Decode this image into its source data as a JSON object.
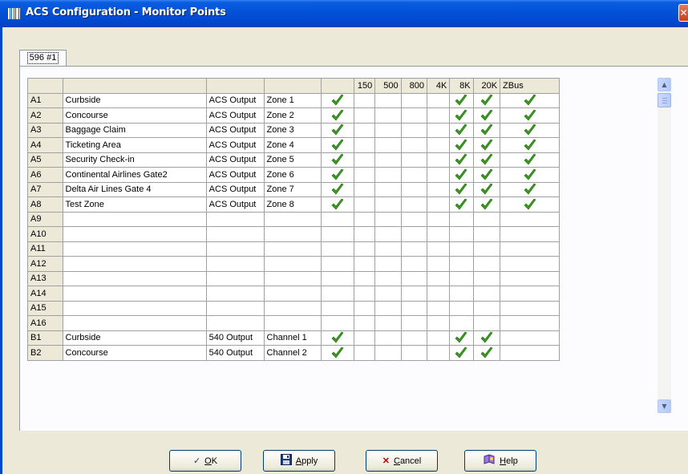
{
  "window": {
    "title": "ACS Configuration - Monitor Points",
    "close_glyph": "✕"
  },
  "tabs": [
    {
      "label": "596 #1",
      "selected": true
    }
  ],
  "grid": {
    "headers": [
      "",
      "",
      "",
      "",
      "",
      "150",
      "500",
      "800",
      "4K",
      "8K",
      "20K",
      "ZBus"
    ],
    "rows": [
      {
        "id": "A1",
        "name": "Curbside",
        "output": "ACS Output",
        "zone": "Zone 1",
        "enabled": true,
        "c150": false,
        "c500": false,
        "c800": false,
        "c4k": false,
        "c8k": true,
        "c20k": true,
        "zbus": true
      },
      {
        "id": "A2",
        "name": "Concourse",
        "output": "ACS Output",
        "zone": "Zone 2",
        "enabled": true,
        "c150": false,
        "c500": false,
        "c800": false,
        "c4k": false,
        "c8k": true,
        "c20k": true,
        "zbus": true
      },
      {
        "id": "A3",
        "name": "Baggage Claim",
        "output": "ACS Output",
        "zone": "Zone 3",
        "enabled": true,
        "c150": false,
        "c500": false,
        "c800": false,
        "c4k": false,
        "c8k": true,
        "c20k": true,
        "zbus": true
      },
      {
        "id": "A4",
        "name": "Ticketing Area",
        "output": "ACS Output",
        "zone": "Zone 4",
        "enabled": true,
        "c150": false,
        "c500": false,
        "c800": false,
        "c4k": false,
        "c8k": true,
        "c20k": true,
        "zbus": true
      },
      {
        "id": "A5",
        "name": "Security Check-in",
        "output": "ACS Output",
        "zone": "Zone 5",
        "enabled": true,
        "c150": false,
        "c500": false,
        "c800": false,
        "c4k": false,
        "c8k": true,
        "c20k": true,
        "zbus": true
      },
      {
        "id": "A6",
        "name": "Continental Airlines Gate2",
        "output": "ACS Output",
        "zone": "Zone 6",
        "enabled": true,
        "c150": false,
        "c500": false,
        "c800": false,
        "c4k": false,
        "c8k": true,
        "c20k": true,
        "zbus": true
      },
      {
        "id": "A7",
        "name": "Delta Air Lines Gate 4",
        "output": "ACS Output",
        "zone": "Zone 7",
        "enabled": true,
        "c150": false,
        "c500": false,
        "c800": false,
        "c4k": false,
        "c8k": true,
        "c20k": true,
        "zbus": true
      },
      {
        "id": "A8",
        "name": "Test Zone",
        "output": "ACS Output",
        "zone": "Zone 8",
        "enabled": true,
        "c150": false,
        "c500": false,
        "c800": false,
        "c4k": false,
        "c8k": true,
        "c20k": true,
        "zbus": true
      },
      {
        "id": "A9",
        "name": "",
        "output": "",
        "zone": "",
        "enabled": false,
        "c150": false,
        "c500": false,
        "c800": false,
        "c4k": false,
        "c8k": false,
        "c20k": false,
        "zbus": false
      },
      {
        "id": "A10",
        "name": "",
        "output": "",
        "zone": "",
        "enabled": false,
        "c150": false,
        "c500": false,
        "c800": false,
        "c4k": false,
        "c8k": false,
        "c20k": false,
        "zbus": false
      },
      {
        "id": "A11",
        "name": "",
        "output": "",
        "zone": "",
        "enabled": false,
        "c150": false,
        "c500": false,
        "c800": false,
        "c4k": false,
        "c8k": false,
        "c20k": false,
        "zbus": false
      },
      {
        "id": "A12",
        "name": "",
        "output": "",
        "zone": "",
        "enabled": false,
        "c150": false,
        "c500": false,
        "c800": false,
        "c4k": false,
        "c8k": false,
        "c20k": false,
        "zbus": false
      },
      {
        "id": "A13",
        "name": "",
        "output": "",
        "zone": "",
        "enabled": false,
        "c150": false,
        "c500": false,
        "c800": false,
        "c4k": false,
        "c8k": false,
        "c20k": false,
        "zbus": false
      },
      {
        "id": "A14",
        "name": "",
        "output": "",
        "zone": "",
        "enabled": false,
        "c150": false,
        "c500": false,
        "c800": false,
        "c4k": false,
        "c8k": false,
        "c20k": false,
        "zbus": false
      },
      {
        "id": "A15",
        "name": "",
        "output": "",
        "zone": "",
        "enabled": false,
        "c150": false,
        "c500": false,
        "c800": false,
        "c4k": false,
        "c8k": false,
        "c20k": false,
        "zbus": false
      },
      {
        "id": "A16",
        "name": "",
        "output": "",
        "zone": "",
        "enabled": false,
        "c150": false,
        "c500": false,
        "c800": false,
        "c4k": false,
        "c8k": false,
        "c20k": false,
        "zbus": false
      },
      {
        "id": "B1",
        "name": "Curbside",
        "output": "540 Output",
        "zone": "Channel 1",
        "enabled": true,
        "c150": false,
        "c500": false,
        "c800": false,
        "c4k": false,
        "c8k": true,
        "c20k": true,
        "zbus": false
      },
      {
        "id": "B2",
        "name": "Concourse",
        "output": "540 Output",
        "zone": "Channel 2",
        "enabled": true,
        "c150": false,
        "c500": false,
        "c800": false,
        "c4k": false,
        "c8k": true,
        "c20k": true,
        "zbus": false
      }
    ],
    "check_icon": "green-checkmark-icon",
    "check_color": "#3a9a1e"
  },
  "scrollbar": {
    "up_glyph": "▲",
    "down_glyph": "▼"
  },
  "buttons": {
    "ok": {
      "icon": "✓",
      "mnemonic": "O",
      "rest": "K"
    },
    "apply": {
      "icon": "save-disk-icon",
      "mnemonic": "A",
      "rest": "pply"
    },
    "cancel": {
      "icon": "✕",
      "mnemonic": "C",
      "rest": "ancel"
    },
    "help": {
      "icon": "help-book-icon",
      "mnemonic": "H",
      "rest": "elp"
    }
  },
  "colors": {
    "titlebar": "#0453d8",
    "face": "#ece9d8",
    "cancel_icon": "#c00000"
  }
}
